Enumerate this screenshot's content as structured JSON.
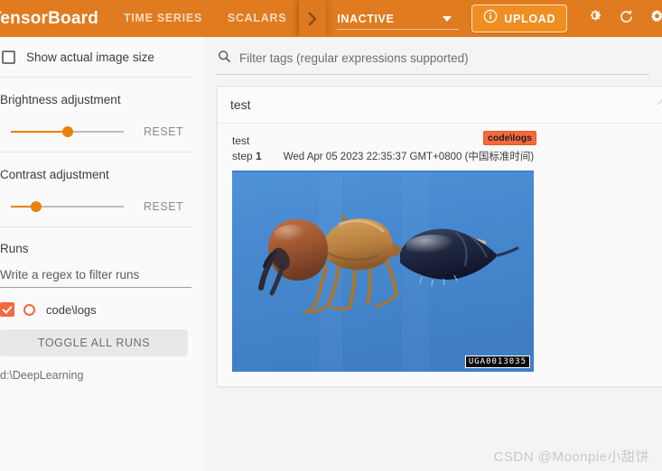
{
  "topbar": {
    "brand": "TensorBoard",
    "tabs": [
      {
        "label": "TIME SERIES"
      },
      {
        "label": "SCALARS"
      }
    ],
    "overflow_icon": "chevron-right-icon",
    "dashboard_select": {
      "value": "INACTIVE"
    },
    "upload": {
      "label": "UPLOAD",
      "icon": "info-circle-icon"
    },
    "icons": [
      {
        "name": "brightness-dark-mode-icon"
      },
      {
        "name": "refresh-icon"
      },
      {
        "name": "settings-gear-icon"
      },
      {
        "name": "help-circle-icon"
      }
    ],
    "accent_color": "#e07b1f",
    "upload_fill": "#ef8f23"
  },
  "sidebar": {
    "show_actual_size": {
      "label": "Show actual image size",
      "checked": false
    },
    "brightness": {
      "label": "Brightness adjustment",
      "reset_label": "RESET",
      "percent": 50
    },
    "contrast": {
      "label": "Contrast adjustment",
      "reset_label": "RESET",
      "percent": 22
    },
    "runs": {
      "title": "Runs",
      "filter_placeholder": "Write a regex to filter runs",
      "filter_value": "",
      "items": [
        {
          "name": "code\\logs",
          "checked": true,
          "color": "#f4683c"
        }
      ],
      "toggle_all_label": "TOGGLE ALL RUNS",
      "logdir": "d:\\DeepLearning"
    }
  },
  "main": {
    "filter": {
      "placeholder": "Filter tags (regular expressions supported)",
      "value": "",
      "icon": "search-icon"
    },
    "card": {
      "title": "test",
      "collapse_icon": "chevron-up-icon",
      "tag": "test",
      "step_label": "step",
      "step_value": "1",
      "timestamp": "Wed Apr 05 2023 22:35:37 GMT+0800 (中国标准时间)",
      "run_badge": "code\\logs",
      "image": {
        "alt": "ant specimen photograph on blue background",
        "watermark": "UGA0013035",
        "background_color": "#4a8ed4"
      }
    }
  },
  "watermark": {
    "text": "CSDN @Moonpie小甜饼"
  }
}
